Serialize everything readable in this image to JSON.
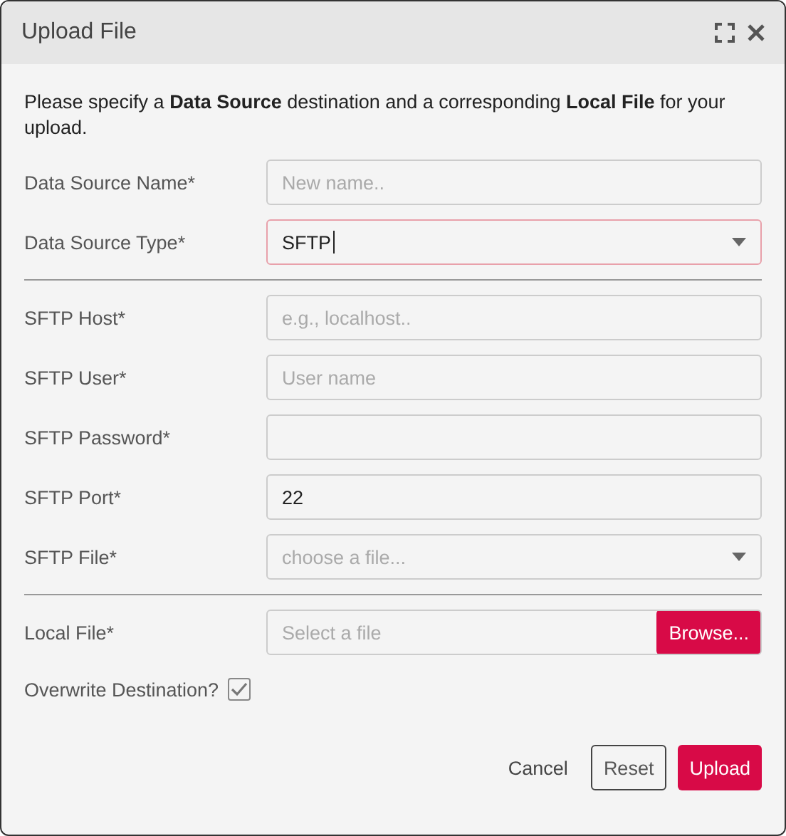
{
  "window": {
    "title": "Upload File"
  },
  "intro": "Please specify a **Data Source** destination and a corresponding **Local File** for your upload.",
  "sections": [
    {
      "fields": [
        {
          "label": "Data Source Name*",
          "kind": "text",
          "placeholder": "New name..",
          "focused": false
        },
        {
          "label": "Data Source Type*",
          "kind": "select",
          "value": "SFTP",
          "focused": true
        }
      ]
    },
    {
      "fields": [
        {
          "label": "SFTP Host*",
          "kind": "text",
          "placeholder": "e.g., localhost..",
          "focused": false
        },
        {
          "label": "SFTP User*",
          "kind": "text",
          "placeholder": "User name",
          "focused": false
        },
        {
          "label": "SFTP Password*",
          "kind": "password",
          "focused": false
        },
        {
          "label": "SFTP Port*",
          "kind": "text",
          "value": "22",
          "focused": false
        },
        {
          "label": "SFTP File*",
          "kind": "select",
          "placeholder": "choose a file...",
          "focused": false
        }
      ]
    },
    {
      "fields": [
        {
          "label": "Local File*",
          "kind": "file",
          "placeholder": "Select a file",
          "button": "Browse...",
          "focused": false
        }
      ]
    }
  ],
  "overwrite": {
    "label": "Overwrite Destination?",
    "checked": true
  },
  "buttons": [
    {
      "label": "Cancel",
      "kind": "text"
    },
    {
      "label": "Reset",
      "kind": "outline"
    },
    {
      "label": "Upload",
      "kind": "primary"
    }
  ]
}
